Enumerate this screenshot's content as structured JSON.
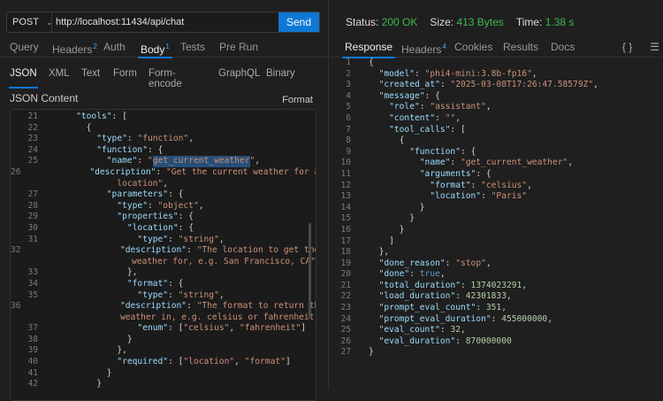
{
  "request": {
    "method": "POST",
    "url": "http://localhost:11434/api/chat",
    "send_label": "Send",
    "tabs": [
      {
        "label": "Query"
      },
      {
        "label": "Headers",
        "badge": "2"
      },
      {
        "label": "Auth"
      },
      {
        "label": "Body",
        "badge": "1"
      },
      {
        "label": "Tests"
      },
      {
        "label": "Pre Run"
      }
    ],
    "body_types": [
      "JSON",
      "XML",
      "Text",
      "Form",
      "Form-encode",
      "GraphQL",
      "Binary"
    ],
    "content_label": "JSON Content",
    "format_label": "Format",
    "lines": [
      {
        "n": "21",
        "i": 4,
        "t": [
          [
            "k",
            "\"tools\""
          ],
          [
            "p",
            ": ["
          ]
        ]
      },
      {
        "n": "22",
        "i": 6,
        "t": [
          [
            "p",
            "{"
          ]
        ]
      },
      {
        "n": "23",
        "i": 8,
        "t": [
          [
            "k",
            "\"type\""
          ],
          [
            "p",
            ": "
          ],
          [
            "s",
            "\"function\""
          ],
          [
            "p",
            ","
          ]
        ]
      },
      {
        "n": "24",
        "i": 8,
        "t": [
          [
            "k",
            "\"function\""
          ],
          [
            "p",
            ": {"
          ]
        ]
      },
      {
        "n": "25",
        "i": 10,
        "t": [
          [
            "k",
            "\"name\""
          ],
          [
            "p",
            ": "
          ],
          [
            "s",
            "\""
          ],
          [
            "hl",
            "get_current_weather"
          ],
          [
            "s",
            "\""
          ],
          [
            "p",
            ","
          ]
        ]
      },
      {
        "n": "26",
        "i": 10,
        "t": [
          [
            "k",
            "\"description\""
          ],
          [
            "p",
            ": "
          ],
          [
            "s",
            "\"Get the current weather for a"
          ]
        ]
      },
      {
        "n": "",
        "i": 12,
        "t": [
          [
            "s",
            "location\""
          ],
          [
            "p",
            ","
          ]
        ]
      },
      {
        "n": "27",
        "i": 10,
        "t": [
          [
            "k",
            "\"parameters\""
          ],
          [
            "p",
            ": {"
          ]
        ]
      },
      {
        "n": "28",
        "i": 12,
        "t": [
          [
            "k",
            "\"type\""
          ],
          [
            "p",
            ": "
          ],
          [
            "s",
            "\"object\""
          ],
          [
            "p",
            ","
          ]
        ]
      },
      {
        "n": "29",
        "i": 12,
        "t": [
          [
            "k",
            "\"properties\""
          ],
          [
            "p",
            ": {"
          ]
        ]
      },
      {
        "n": "30",
        "i": 14,
        "t": [
          [
            "k",
            "\"location\""
          ],
          [
            "p",
            ": {"
          ]
        ]
      },
      {
        "n": "31",
        "i": 16,
        "t": [
          [
            "k",
            "\"type\""
          ],
          [
            "p",
            ": "
          ],
          [
            "s",
            "\"string\""
          ],
          [
            "p",
            ","
          ]
        ]
      },
      {
        "n": "32",
        "i": 16,
        "t": [
          [
            "k",
            "\"description\""
          ],
          [
            "p",
            ": "
          ],
          [
            "s",
            "\"The location to get the"
          ]
        ]
      },
      {
        "n": "",
        "i": 18,
        "t": [
          [
            "s",
            "weather for, e.g. San Francisco, CA\""
          ]
        ]
      },
      {
        "n": "33",
        "i": 14,
        "t": [
          [
            "p",
            "},"
          ]
        ]
      },
      {
        "n": "34",
        "i": 14,
        "t": [
          [
            "k",
            "\"format\""
          ],
          [
            "p",
            ": {"
          ]
        ]
      },
      {
        "n": "35",
        "i": 16,
        "t": [
          [
            "k",
            "\"type\""
          ],
          [
            "p",
            ": "
          ],
          [
            "s",
            "\"string\""
          ],
          [
            "p",
            ","
          ]
        ]
      },
      {
        "n": "36",
        "i": 16,
        "t": [
          [
            "k",
            "\"description\""
          ],
          [
            "p",
            ": "
          ],
          [
            "s",
            "\"The format to return the"
          ]
        ]
      },
      {
        "n": "",
        "i": 18,
        "t": [
          [
            "s",
            "weather in, e.g. celsius or fahrenheit\""
          ],
          [
            "p",
            ","
          ]
        ]
      },
      {
        "n": "37",
        "i": 16,
        "t": [
          [
            "k",
            "\"enum\""
          ],
          [
            "p",
            ": ["
          ],
          [
            "s",
            "\"celsius\""
          ],
          [
            "p",
            ", "
          ],
          [
            "s",
            "\"fahrenheit\""
          ],
          [
            "p",
            "]"
          ]
        ]
      },
      {
        "n": "38",
        "i": 14,
        "t": [
          [
            "p",
            "}"
          ]
        ]
      },
      {
        "n": "39",
        "i": 12,
        "t": [
          [
            "p",
            "},"
          ]
        ]
      },
      {
        "n": "40",
        "i": 12,
        "t": [
          [
            "k",
            "\"required\""
          ],
          [
            "p",
            ": ["
          ],
          [
            "s",
            "\"location\""
          ],
          [
            "p",
            ", "
          ],
          [
            "s",
            "\"format\""
          ],
          [
            "p",
            "]"
          ]
        ]
      },
      {
        "n": "41",
        "i": 10,
        "t": [
          [
            "p",
            "}"
          ]
        ]
      },
      {
        "n": "42",
        "i": 8,
        "t": [
          [
            "p",
            "}"
          ]
        ]
      }
    ]
  },
  "response": {
    "status_label": "Status:",
    "status": "200 OK",
    "size_label": "Size:",
    "size": "413 Bytes",
    "time_label": "Time:",
    "time": "1.38 s",
    "tabs": [
      {
        "label": "Response"
      },
      {
        "label": "Headers",
        "badge": "4"
      },
      {
        "label": "Cookies"
      },
      {
        "label": "Results"
      },
      {
        "label": "Docs"
      }
    ],
    "icons": {
      "braces": "{ }",
      "menu": "☰"
    },
    "lines": [
      {
        "n": "1",
        "i": 0,
        "t": [
          [
            "p",
            "{"
          ]
        ]
      },
      {
        "n": "2",
        "i": 2,
        "t": [
          [
            "k",
            "\"model\""
          ],
          [
            "p",
            ": "
          ],
          [
            "s",
            "\"phi4-mini:3.8b-fp16\""
          ],
          [
            "p",
            ","
          ]
        ]
      },
      {
        "n": "3",
        "i": 2,
        "t": [
          [
            "k",
            "\"created_at\""
          ],
          [
            "p",
            ": "
          ],
          [
            "s",
            "\"2025-03-08T17:26:47.58579Z\""
          ],
          [
            "p",
            ","
          ]
        ]
      },
      {
        "n": "4",
        "i": 2,
        "t": [
          [
            "k",
            "\"message\""
          ],
          [
            "p",
            ": {"
          ]
        ]
      },
      {
        "n": "5",
        "i": 4,
        "t": [
          [
            "k",
            "\"role\""
          ],
          [
            "p",
            ": "
          ],
          [
            "s",
            "\"assistant\""
          ],
          [
            "p",
            ","
          ]
        ]
      },
      {
        "n": "6",
        "i": 4,
        "t": [
          [
            "k",
            "\"content\""
          ],
          [
            "p",
            ": "
          ],
          [
            "s",
            "\"\""
          ],
          [
            "p",
            ","
          ]
        ]
      },
      {
        "n": "7",
        "i": 4,
        "t": [
          [
            "k",
            "\"tool_calls\""
          ],
          [
            "p",
            ": ["
          ]
        ]
      },
      {
        "n": "8",
        "i": 6,
        "t": [
          [
            "p",
            "{"
          ]
        ]
      },
      {
        "n": "9",
        "i": 8,
        "t": [
          [
            "k",
            "\"function\""
          ],
          [
            "p",
            ": {"
          ]
        ]
      },
      {
        "n": "10",
        "i": 10,
        "t": [
          [
            "k",
            "\"name\""
          ],
          [
            "p",
            ": "
          ],
          [
            "s",
            "\"get_current_weather\""
          ],
          [
            "p",
            ","
          ]
        ]
      },
      {
        "n": "11",
        "i": 10,
        "t": [
          [
            "k",
            "\"arguments\""
          ],
          [
            "p",
            ": {"
          ]
        ]
      },
      {
        "n": "12",
        "i": 12,
        "t": [
          [
            "k",
            "\"format\""
          ],
          [
            "p",
            ": "
          ],
          [
            "s",
            "\"celsius\""
          ],
          [
            "p",
            ","
          ]
        ]
      },
      {
        "n": "13",
        "i": 12,
        "t": [
          [
            "k",
            "\"location\""
          ],
          [
            "p",
            ": "
          ],
          [
            "s",
            "\"Paris\""
          ]
        ]
      },
      {
        "n": "14",
        "i": 10,
        "t": [
          [
            "p",
            "}"
          ]
        ]
      },
      {
        "n": "15",
        "i": 8,
        "t": [
          [
            "p",
            "}"
          ]
        ]
      },
      {
        "n": "16",
        "i": 6,
        "t": [
          [
            "p",
            "}"
          ]
        ]
      },
      {
        "n": "17",
        "i": 4,
        "t": [
          [
            "p",
            "]"
          ]
        ]
      },
      {
        "n": "18",
        "i": 2,
        "t": [
          [
            "p",
            "},"
          ]
        ]
      },
      {
        "n": "19",
        "i": 2,
        "t": [
          [
            "k",
            "\"done_reason\""
          ],
          [
            "p",
            ": "
          ],
          [
            "s",
            "\"stop\""
          ],
          [
            "p",
            ","
          ]
        ]
      },
      {
        "n": "20",
        "i": 2,
        "t": [
          [
            "k",
            "\"done\""
          ],
          [
            "p",
            ": "
          ],
          [
            "b",
            "true"
          ],
          [
            "p",
            ","
          ]
        ]
      },
      {
        "n": "21",
        "i": 2,
        "t": [
          [
            "k",
            "\"total_duration\""
          ],
          [
            "p",
            ": "
          ],
          [
            "n",
            "1374023291"
          ],
          [
            "p",
            ","
          ]
        ]
      },
      {
        "n": "22",
        "i": 2,
        "t": [
          [
            "k",
            "\"load_duration\""
          ],
          [
            "p",
            ": "
          ],
          [
            "n",
            "42301833"
          ],
          [
            "p",
            ","
          ]
        ]
      },
      {
        "n": "23",
        "i": 2,
        "t": [
          [
            "k",
            "\"prompt_eval_count\""
          ],
          [
            "p",
            ": "
          ],
          [
            "n",
            "351"
          ],
          [
            "p",
            ","
          ]
        ]
      },
      {
        "n": "24",
        "i": 2,
        "t": [
          [
            "k",
            "\"prompt_eval_duration\""
          ],
          [
            "p",
            ": "
          ],
          [
            "n",
            "455000000"
          ],
          [
            "p",
            ","
          ]
        ]
      },
      {
        "n": "25",
        "i": 2,
        "t": [
          [
            "k",
            "\"eval_count\""
          ],
          [
            "p",
            ": "
          ],
          [
            "n",
            "32"
          ],
          [
            "p",
            ","
          ]
        ]
      },
      {
        "n": "26",
        "i": 2,
        "t": [
          [
            "k",
            "\"eval_duration\""
          ],
          [
            "p",
            ": "
          ],
          [
            "n",
            "870000000"
          ]
        ]
      },
      {
        "n": "27",
        "i": 0,
        "t": [
          [
            "p",
            "}"
          ]
        ]
      }
    ]
  },
  "colors": {
    "accent": "#0e78d5",
    "success": "#3fb950",
    "key": "#9cdcfe",
    "string": "#ce9178"
  }
}
